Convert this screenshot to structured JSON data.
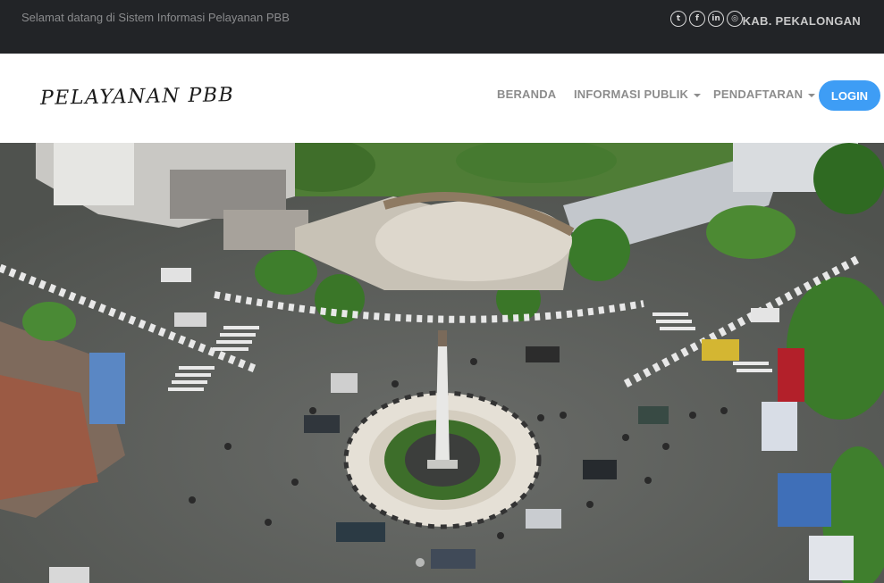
{
  "topbar": {
    "welcome": "Selamat datang di Sistem Informasi Pelayanan PBB",
    "region": "KAB. PEKALONGAN",
    "social": [
      {
        "icon": "twitter-icon",
        "glyph": "t"
      },
      {
        "icon": "facebook-icon",
        "glyph": "f"
      },
      {
        "icon": "linkedin-icon",
        "glyph": "in"
      },
      {
        "icon": "dribbble-icon",
        "glyph": "◎"
      }
    ]
  },
  "navbar": {
    "brand": "PELAYANAN PBB",
    "items": [
      {
        "label": "BERANDA"
      },
      {
        "label": "INFORMASI PUBLIK"
      },
      {
        "label": "PENDAFTARAN"
      }
    ],
    "login": "LOGIN"
  },
  "colors": {
    "topbar_bg": "#222427",
    "login_bg": "#3e9df5",
    "road": "#5f615e",
    "greenery": "#3f7a2e"
  }
}
